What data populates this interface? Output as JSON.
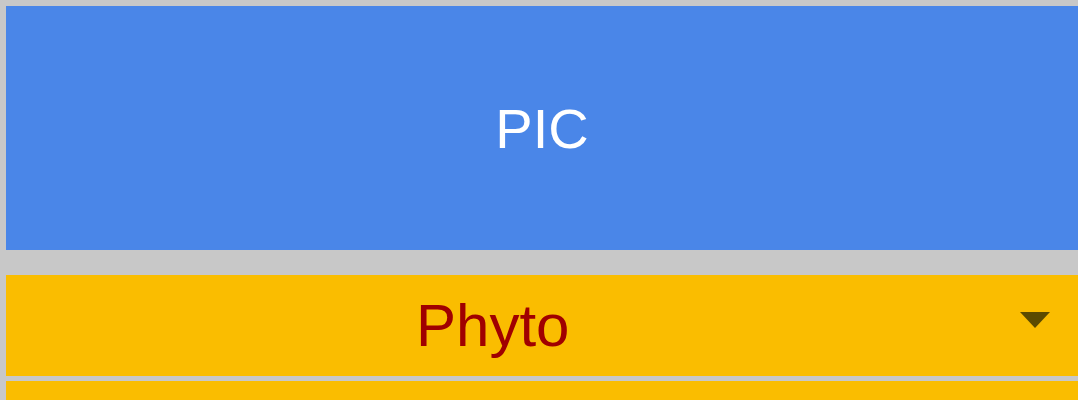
{
  "header": {
    "label": "PIC"
  },
  "dropdown": {
    "value": "Phyto"
  }
}
